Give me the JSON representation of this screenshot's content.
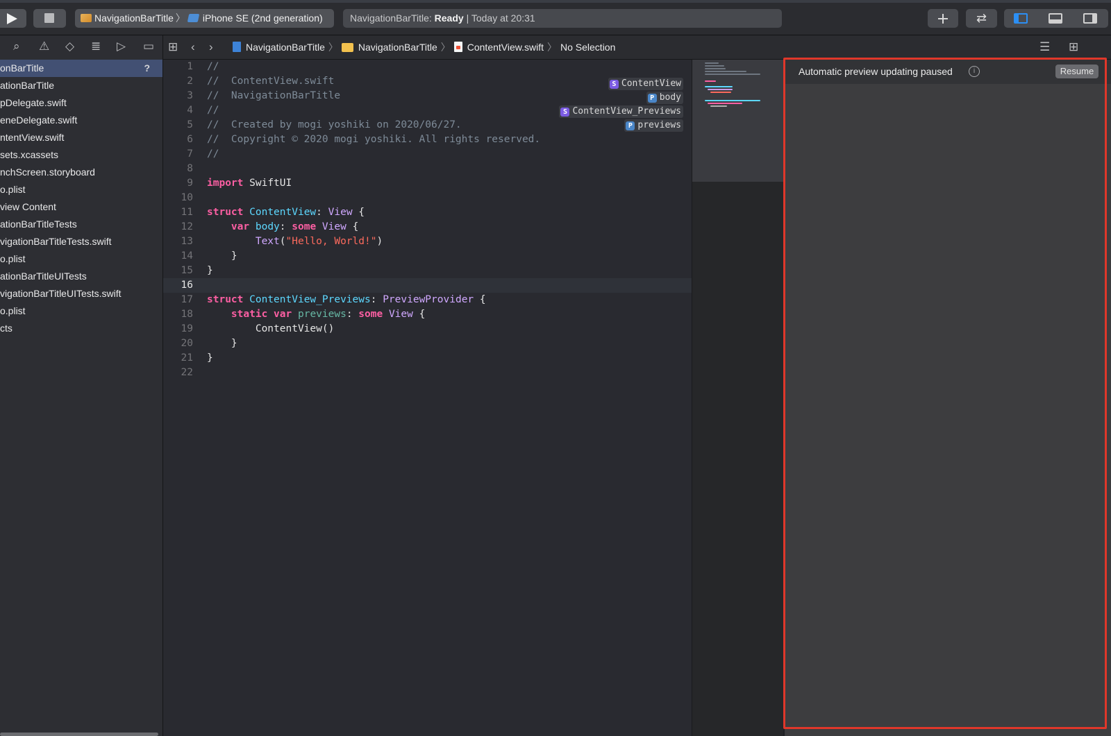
{
  "toolbar": {
    "scheme_name": "NavigationBarTitle",
    "device_name": "iPhone SE (2nd generation)",
    "status_project": "NavigationBarTitle:",
    "status_state": "Ready",
    "status_time": "| Today at 20:31"
  },
  "navigator": {
    "items": [
      {
        "label": "onBarTitle",
        "badge": "?"
      },
      {
        "label": "ationBarTitle"
      },
      {
        "label": "pDelegate.swift"
      },
      {
        "label": "eneDelegate.swift"
      },
      {
        "label": "ntentView.swift"
      },
      {
        "label": "sets.xcassets"
      },
      {
        "label": "nchScreen.storyboard"
      },
      {
        "label": "o.plist"
      },
      {
        "label": "view Content"
      },
      {
        "label": "ationBarTitleTests"
      },
      {
        "label": "vigationBarTitleTests.swift"
      },
      {
        "label": "o.plist"
      },
      {
        "label": "ationBarTitleUITests"
      },
      {
        "label": "vigationBarTitleUITests.swift"
      },
      {
        "label": "o.plist"
      },
      {
        "label": "cts"
      }
    ]
  },
  "jumpbar": {
    "project": "NavigationBarTitle",
    "group": "NavigationBarTitle",
    "file": "ContentView.swift",
    "selection": "No Selection"
  },
  "editor": {
    "line_numbers": [
      "1",
      "2",
      "3",
      "4",
      "5",
      "6",
      "7",
      "8",
      "9",
      "10",
      "11",
      "12",
      "13",
      "14",
      "15",
      "16",
      "17",
      "18",
      "19",
      "20",
      "21",
      "22"
    ],
    "current_line": "16",
    "comments": {
      "c1": "//",
      "c2": "//  ContentView.swift",
      "c3": "//  NavigationBarTitle",
      "c4": "//",
      "c5": "//  Created by mogi yoshiki on 2020/06/27.",
      "c6": "//  Copyright © 2020 mogi yoshiki. All rights reserved.",
      "c7": "//"
    },
    "tokens": {
      "import": "import",
      "swiftui": "SwiftUI",
      "struct": "struct",
      "content_view": "ContentView",
      "colon": ":",
      "view": "View",
      "open_brace": "{",
      "var": "var",
      "body": "body",
      "some": "some",
      "text": "Text",
      "lparen": "(",
      "hello": "\"Hello, World!\"",
      "rparen": ")",
      "close_brace": "}",
      "content_view_previews": "ContentView_Previews",
      "preview_provider": "PreviewProvider",
      "static": "static",
      "previews": "previews",
      "content_view_call": "ContentView",
      "call_parens": "()"
    }
  },
  "marks": [
    {
      "kind": "S",
      "label": "ContentView"
    },
    {
      "kind": "P",
      "label": "body"
    },
    {
      "kind": "S",
      "label": "ContentView_Previews"
    },
    {
      "kind": "P",
      "label": "previews"
    }
  ],
  "preview": {
    "message": "Automatic preview updating paused",
    "info_glyph": "i",
    "resume_label": "Resume"
  },
  "colors": {
    "keyword": "#fc5fa3",
    "type": "#5dd8ff",
    "string": "#fc6a5d",
    "comment": "#7e8b98",
    "highlight_box": "#e0372a",
    "selection": "#425073"
  }
}
